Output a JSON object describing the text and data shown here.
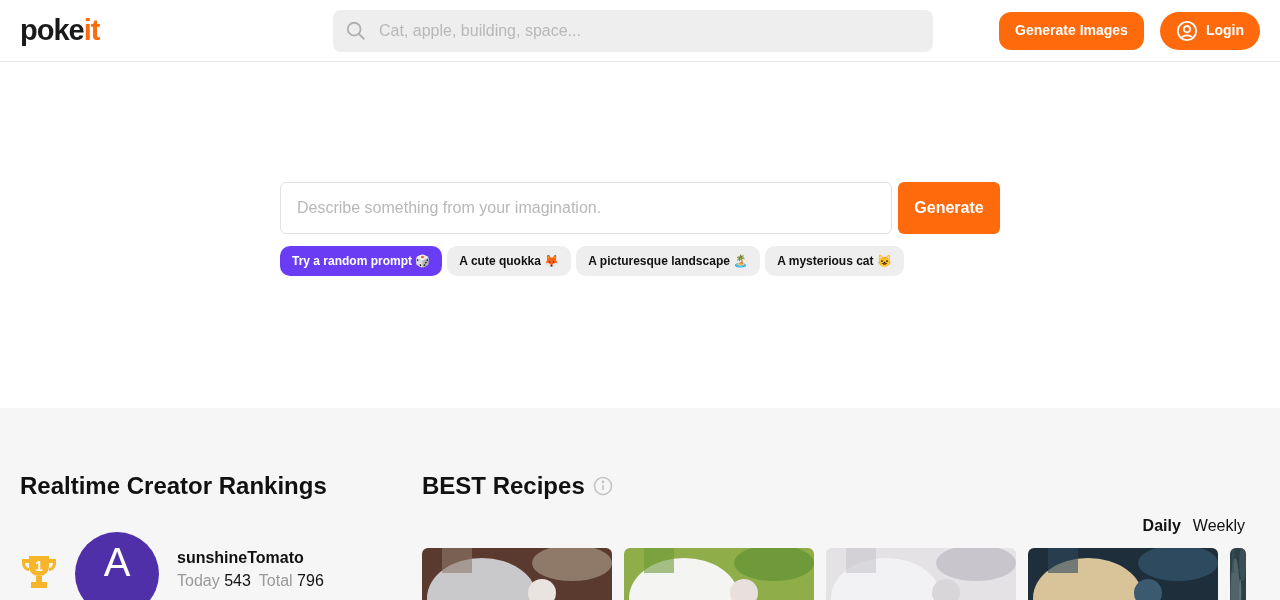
{
  "header": {
    "logo": {
      "main": "poke",
      "accent": "it"
    },
    "search": {
      "placeholder": "Cat, apple, building, space..."
    },
    "buttons": [
      {
        "kind": "plain",
        "label": "Generate Images"
      },
      {
        "kind": "user",
        "label": "Login"
      }
    ]
  },
  "hero": {
    "prompt": {
      "placeholder": "Describe something from your imagination."
    },
    "generate": "Generate",
    "chips": [
      {
        "label": "Try a random prompt 🎲",
        "selected": true
      },
      {
        "label": "A cute quokka 🦊",
        "selected": false
      },
      {
        "label": "A picturesque landscape 🏝️",
        "selected": false
      },
      {
        "label": "A mysterious cat 😺",
        "selected": false
      }
    ]
  },
  "rankings": {
    "title": "Realtime Creator Rankings",
    "creators": [
      {
        "rank": "1",
        "initial": "A",
        "color": "#5030a8",
        "name": "sunshineTomato",
        "today_label": "Today",
        "today": "543",
        "total_label": "Total",
        "total": "796"
      }
    ]
  },
  "recipes": {
    "title": "BEST Recipes",
    "tabs": [
      {
        "label": "Daily",
        "selected": true
      },
      {
        "label": "Weekly",
        "selected": false
      }
    ]
  }
}
